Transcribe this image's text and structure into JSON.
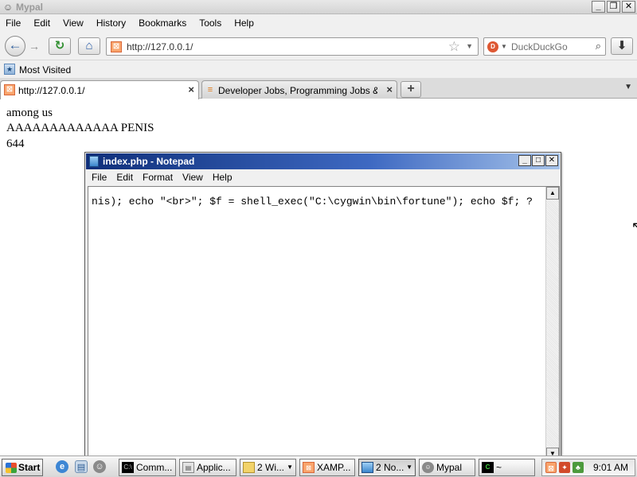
{
  "window": {
    "title": "Mypal",
    "minimize": "_",
    "restore": "❐",
    "close": "✕"
  },
  "menu": [
    "File",
    "Edit",
    "View",
    "History",
    "Bookmarks",
    "Tools",
    "Help"
  ],
  "nav": {
    "back_glyph": "←",
    "forward_glyph": "→",
    "reload_glyph": "↻",
    "home_glyph": "⌂",
    "download_glyph": "⬇",
    "url": "http://127.0.0.1/",
    "search_placeholder": "DuckDuckGo",
    "search_glyph": "⌕"
  },
  "bookmarks": {
    "most_visited": "Most Visited"
  },
  "tabs": [
    {
      "label": "http://127.0.0.1/",
      "active": true
    },
    {
      "label": "Developer Jobs, Programming Jobs & Mo...",
      "active": false
    }
  ],
  "page_content": {
    "lines": [
      "among us",
      "AAAAAAAAAAAAA PENIS",
      "644"
    ]
  },
  "notepad": {
    "title": "index.php - Notepad",
    "menu": [
      "File",
      "Edit",
      "Format",
      "View",
      "Help"
    ],
    "text": "nis); echo \"<br>\"; $f = shell_exec(\"C:\\cygwin\\bin\\fortune\"); echo $f; ?"
  },
  "taskbar": {
    "start_label": "Start",
    "buttons": [
      {
        "label": "Comm...",
        "icon_text": "C:\\"
      },
      {
        "label": "Applic...",
        "icon_text": "▤"
      },
      {
        "label": "2 Wi...",
        "icon_text": ""
      },
      {
        "label": "XAMP...",
        "icon_text": "⊠"
      },
      {
        "label": "2 No...",
        "icon_text": ""
      },
      {
        "label": "Mypal",
        "icon_text": ""
      },
      {
        "label": "~",
        "icon_text": "C"
      }
    ],
    "clock": "9:01 AM"
  },
  "colors": {
    "notepad_title_start": "#0f2f7a",
    "notepad_title_end": "#a6c3ea",
    "xampp_orange": "#f9a46c"
  }
}
